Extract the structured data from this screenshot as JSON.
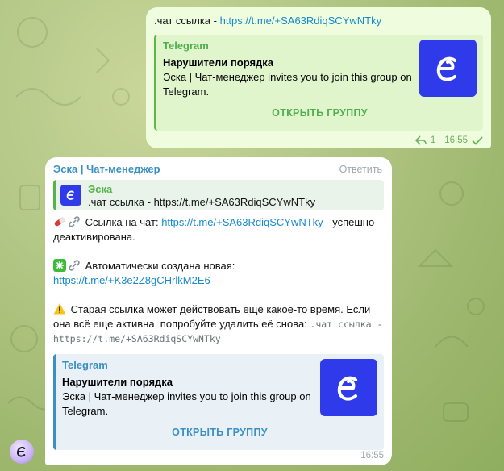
{
  "outgoing": {
    "text_prefix": ".чат ссылка - ",
    "link": "https://t.me/+SA63RdiqSCYwNTky",
    "preview": {
      "site": "Telegram",
      "title": "Нарушители порядка",
      "description": "Эска | Чат-менеджер invites you to join this group on Telegram.",
      "button": "ОТКРЫТЬ ГРУППУ"
    },
    "replies_count": "1",
    "time": "16:55"
  },
  "incoming": {
    "sender": "Эска | Чат-менеджер",
    "reply_label": "Ответить",
    "quote": {
      "name": "Эска",
      "text": ".чат ссылка - https://t.me/+SA63RdiqSCYwNTky"
    },
    "p1_label": "Ссылка на чат: ",
    "p1_link": "https://t.me/+SA63RdiqSCYwNTky",
    "p1_suffix": " - успешно деактивирована.",
    "p2_label": "Автоматически создана новая:",
    "p2_link": "https://t.me/+K3e2Z8gCHrlkM2E6",
    "p3_text": "Старая ссылка может действовать ещё какое-то время. Если она всё еще активна, попробуйте удалить её снова: ",
    "p3_code": ".чат ссылка - https://t.me/+SA63RdiqSCYwNTky",
    "preview": {
      "site": "Telegram",
      "title": "Нарушители порядка",
      "description": "Эска | Чат-менеджер invites you to join this group on Telegram.",
      "button": "ОТКРЫТЬ ГРУППУ"
    },
    "time": "16:55"
  },
  "colors": {
    "outgoing_bubble": "#effdde",
    "incoming_bubble": "#ffffff",
    "link": "#168acd",
    "logo_bg": "#2f3bea"
  },
  "icons": [
    "reply-arrow-icon",
    "check-icon",
    "pill-icon",
    "link-icon",
    "sparkle-icon",
    "warning-icon",
    "bot-avatar"
  ]
}
